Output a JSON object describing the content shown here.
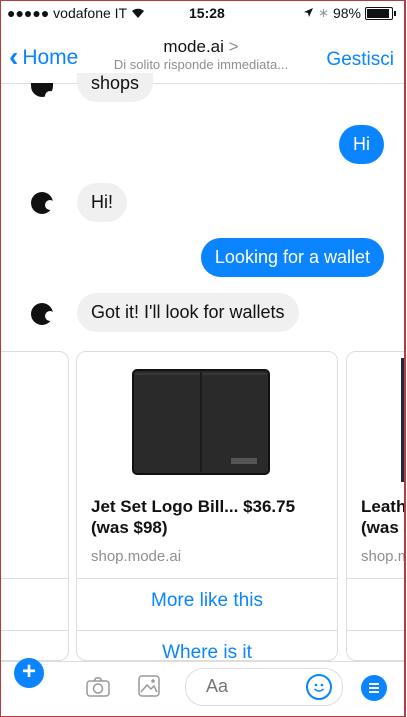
{
  "status_bar": {
    "carrier": "●●●●● vodafone IT",
    "wifi_icon": "△",
    "time": "15:28",
    "location_icon": "➤",
    "bluetooth_icon": "✱",
    "battery": "98%"
  },
  "nav": {
    "back_label": "Home",
    "title": "mode.ai",
    "title_chevron": ">",
    "subtitle": "Di solito risponde immediata...",
    "manage_label": "Gestisci"
  },
  "messages": [
    {
      "from": "bot",
      "text": "shops"
    },
    {
      "from": "user",
      "text": "Hi"
    },
    {
      "from": "bot",
      "text": "Hi!"
    },
    {
      "from": "user",
      "text": "Looking for a wallet"
    },
    {
      "from": "bot",
      "text": "Got it! I'll look for wallets"
    }
  ],
  "carousel": {
    "cards": [
      {
        "title_line1": "Jet Set Logo Bill... $36.75",
        "title_line2": "(was $98)",
        "domain": "shop.mode.ai",
        "button1": "More like this",
        "button2": "Where is it"
      },
      {
        "title_line1": "Leath",
        "title_line2": "(was $",
        "domain": "shop.m"
      }
    ]
  },
  "composer": {
    "placeholder": "Aa"
  },
  "colors": {
    "accent": "#0a84ff",
    "bubble_incoming": "#f0f0f0",
    "frame_border": "#b43c3c"
  }
}
